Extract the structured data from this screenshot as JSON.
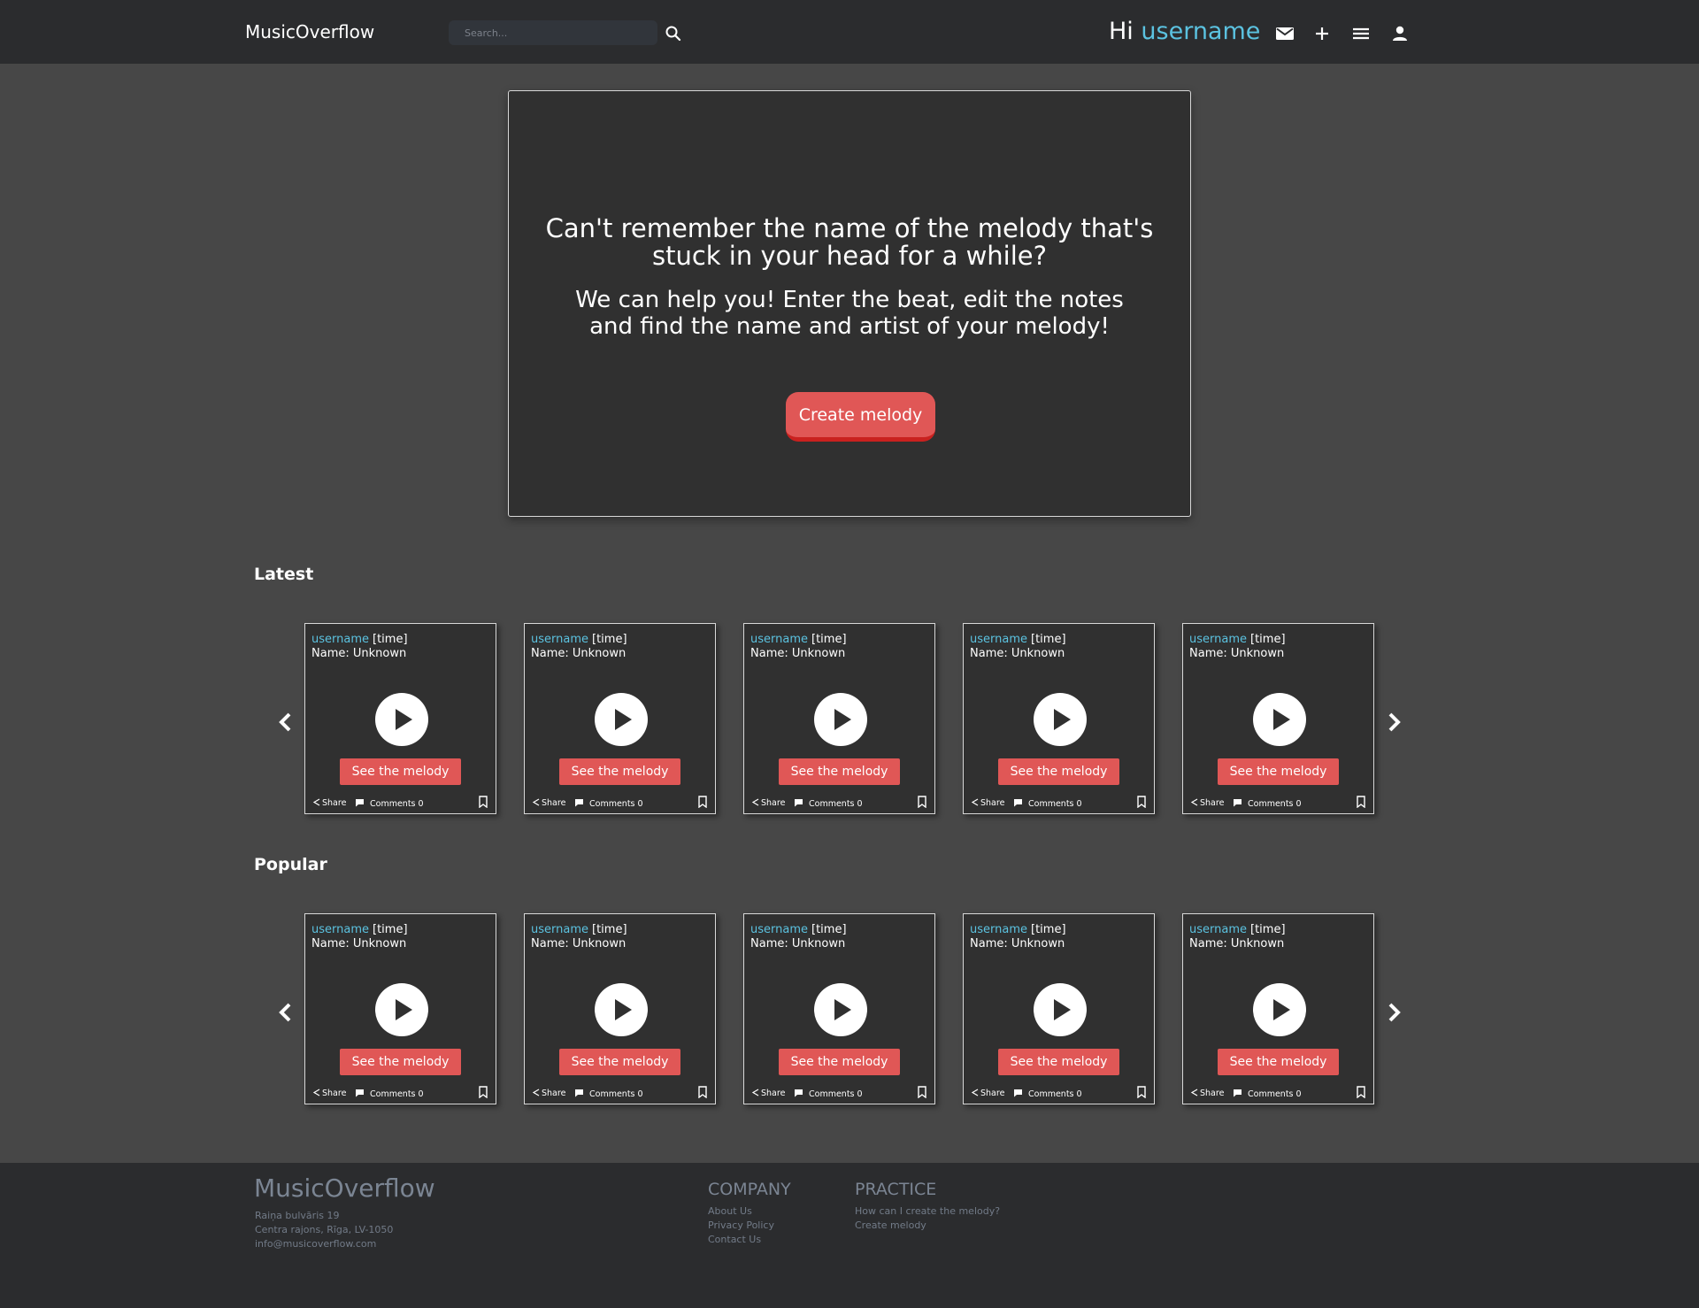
{
  "header": {
    "brand": "MusicOverflow",
    "search_placeholder": "Search...",
    "greeting": "Hi",
    "username": "username",
    "icons": [
      "mail-icon",
      "plus-icon",
      "menu-icon",
      "user-icon"
    ]
  },
  "hero": {
    "title": "Can't remember the name of the melody that's stuck in your head for a while?",
    "subtitle": "We can help you! Enter the beat, edit the notes and find the name and artist of your melody!",
    "cta_label": "Create melody"
  },
  "sections": [
    {
      "title": "Latest",
      "cards": [
        {
          "username": "username",
          "time": "[time]",
          "name": "Name: Unknown",
          "button": "See the melody",
          "share": "Share",
          "comments": "Comments 0"
        },
        {
          "username": "username",
          "time": "[time]",
          "name": "Name: Unknown",
          "button": "See the melody",
          "share": "Share",
          "comments": "Comments 0"
        },
        {
          "username": "username",
          "time": "[time]",
          "name": "Name: Unknown",
          "button": "See the melody",
          "share": "Share",
          "comments": "Comments 0"
        },
        {
          "username": "username",
          "time": "[time]",
          "name": "Name: Unknown",
          "button": "See the melody",
          "share": "Share",
          "comments": "Comments 0"
        },
        {
          "username": "username",
          "time": "[time]",
          "name": "Name: Unknown",
          "button": "See the melody",
          "share": "Share",
          "comments": "Comments 0"
        }
      ]
    },
    {
      "title": "Popular",
      "cards": [
        {
          "username": "username",
          "time": "[time]",
          "name": "Name: Unknown",
          "button": "See the melody",
          "share": "Share",
          "comments": "Comments 0"
        },
        {
          "username": "username",
          "time": "[time]",
          "name": "Name: Unknown",
          "button": "See the melody",
          "share": "Share",
          "comments": "Comments 0"
        },
        {
          "username": "username",
          "time": "[time]",
          "name": "Name: Unknown",
          "button": "See the melody",
          "share": "Share",
          "comments": "Comments 0"
        },
        {
          "username": "username",
          "time": "[time]",
          "name": "Name: Unknown",
          "button": "See the melody",
          "share": "Share",
          "comments": "Comments 0"
        },
        {
          "username": "username",
          "time": "[time]",
          "name": "Name: Unknown",
          "button": "See the melody",
          "share": "Share",
          "comments": "Comments 0"
        }
      ]
    }
  ],
  "footer": {
    "brand": "MusicOverflow",
    "address": [
      "Raiņa bulvāris 19",
      "Centra rajons, Rīga, LV-1050",
      "info@musicoverflow.com"
    ],
    "company": {
      "heading": "COMPANY",
      "links": [
        "About Us",
        "Privacy Policy",
        "Contact Us"
      ]
    },
    "practice": {
      "heading": "PRACTICE",
      "links": [
        "How can I create the melody?",
        "Create melody"
      ]
    }
  },
  "colors": {
    "accent": "#5bc2e0",
    "button": "#e05756",
    "button_shadow": "#c9211f",
    "page_bg": "#474747",
    "bar_bg": "#2b2c2e",
    "card_bg": "#303030"
  }
}
